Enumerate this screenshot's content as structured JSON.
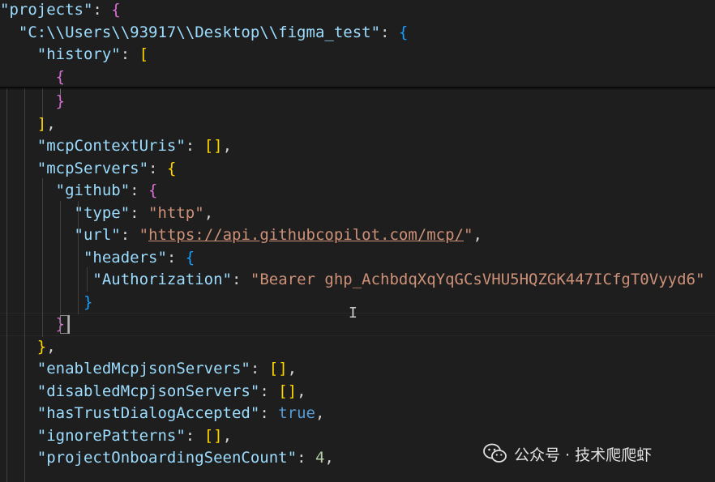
{
  "editor": {
    "top_lines": [
      [
        {
          "t": "\"projects\"",
          "c": "k"
        },
        {
          "t": ": ",
          "c": "p"
        },
        {
          "t": "{",
          "c": "b1"
        }
      ],
      [
        {
          "t": "  ",
          "c": "p"
        },
        {
          "t": "\"C:\\\\Users\\\\93917\\\\Desktop\\\\figma_test\"",
          "c": "k"
        },
        {
          "t": ": ",
          "c": "p"
        },
        {
          "t": "{",
          "c": "b3"
        }
      ],
      [
        {
          "t": "    ",
          "c": "p"
        },
        {
          "t": "\"history\"",
          "c": "k"
        },
        {
          "t": ": ",
          "c": "p"
        },
        {
          "t": "[",
          "c": "b2"
        }
      ],
      [
        {
          "t": "      ",
          "c": "p"
        },
        {
          "t": "{",
          "c": "b1"
        }
      ]
    ],
    "lines": [
      [
        {
          "t": "      ",
          "c": "p"
        },
        {
          "t": "}",
          "c": "b1"
        }
      ],
      [
        {
          "t": "    ",
          "c": "p"
        },
        {
          "t": "]",
          "c": "b2"
        },
        {
          "t": ",",
          "c": "p"
        }
      ],
      [
        {
          "t": "    ",
          "c": "p"
        },
        {
          "t": "\"mcpContextUris\"",
          "c": "k"
        },
        {
          "t": ": ",
          "c": "p"
        },
        {
          "t": "[]",
          "c": "b2"
        },
        {
          "t": ",",
          "c": "p"
        }
      ],
      [
        {
          "t": "    ",
          "c": "p"
        },
        {
          "t": "\"mcpServers\"",
          "c": "k"
        },
        {
          "t": ": ",
          "c": "p"
        },
        {
          "t": "{",
          "c": "b2"
        }
      ],
      [
        {
          "t": "      ",
          "c": "p"
        },
        {
          "t": "\"github\"",
          "c": "k"
        },
        {
          "t": ": ",
          "c": "p"
        },
        {
          "t": "{",
          "c": "b1"
        }
      ],
      [
        {
          "t": "        ",
          "c": "p"
        },
        {
          "t": "\"type\"",
          "c": "k"
        },
        {
          "t": ": ",
          "c": "p"
        },
        {
          "t": "\"http\"",
          "c": "s"
        },
        {
          "t": ",",
          "c": "p"
        }
      ],
      [
        {
          "t": "        ",
          "c": "p"
        },
        {
          "t": "\"url\"",
          "c": "k"
        },
        {
          "t": ": ",
          "c": "p"
        },
        {
          "t": "\"",
          "c": "s"
        },
        {
          "t": "https://api.githubcopilot.com/mcp/",
          "c": "s u"
        },
        {
          "t": "\"",
          "c": "s"
        },
        {
          "t": ",",
          "c": "p"
        }
      ],
      [
        {
          "t": "         ",
          "c": "p"
        },
        {
          "t": "\"headers\"",
          "c": "k"
        },
        {
          "t": ": ",
          "c": "p"
        },
        {
          "t": "{",
          "c": "b3"
        }
      ],
      [
        {
          "t": "          ",
          "c": "p"
        },
        {
          "t": "\"Authorization\"",
          "c": "k"
        },
        {
          "t": ": ",
          "c": "p"
        },
        {
          "t": "\"Bearer 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\"",
          "c": "s"
        }
      ],
      [
        {
          "t": "         ",
          "c": "p"
        },
        {
          "t": "}",
          "c": "b3"
        }
      ],
      [
        {
          "t": "      ",
          "c": "p"
        },
        {
          "t": "}",
          "c": "b1"
        }
      ],
      [
        {
          "t": "    ",
          "c": "p"
        },
        {
          "t": "}",
          "c": "b2"
        },
        {
          "t": ",",
          "c": "p"
        }
      ],
      [
        {
          "t": "    ",
          "c": "p"
        },
        {
          "t": "\"enabledMcpjsonServers\"",
          "c": "k"
        },
        {
          "t": ": ",
          "c": "p"
        },
        {
          "t": "[]",
          "c": "b2"
        },
        {
          "t": ",",
          "c": "p"
        }
      ],
      [
        {
          "t": "    ",
          "c": "p"
        },
        {
          "t": "\"disabledMcpjsonServers\"",
          "c": "k"
        },
        {
          "t": ": ",
          "c": "p"
        },
        {
          "t": "[]",
          "c": "b2"
        },
        {
          "t": ",",
          "c": "p"
        }
      ],
      [
        {
          "t": "    ",
          "c": "p"
        },
        {
          "t": "\"hasTrustDialogAccepted\"",
          "c": "k"
        },
        {
          "t": ": ",
          "c": "p"
        },
        {
          "t": "true",
          "c": "kw"
        },
        {
          "t": ",",
          "c": "p"
        }
      ],
      [
        {
          "t": "    ",
          "c": "p"
        },
        {
          "t": "\"ignorePatterns\"",
          "c": "k"
        },
        {
          "t": ": ",
          "c": "p"
        },
        {
          "t": "[]",
          "c": "b2"
        },
        {
          "t": ",",
          "c": "p"
        }
      ],
      [
        {
          "t": "    ",
          "c": "p"
        },
        {
          "t": "\"projectOnboardingSeenCount\"",
          "c": "k"
        },
        {
          "t": ": ",
          "c": "p"
        },
        {
          "t": "4",
          "c": "n"
        },
        {
          "t": ",",
          "c": "p"
        }
      ]
    ]
  },
  "watermark": {
    "icon": "wechat-icon",
    "text": "公众号 · 技术爬爬虾"
  }
}
